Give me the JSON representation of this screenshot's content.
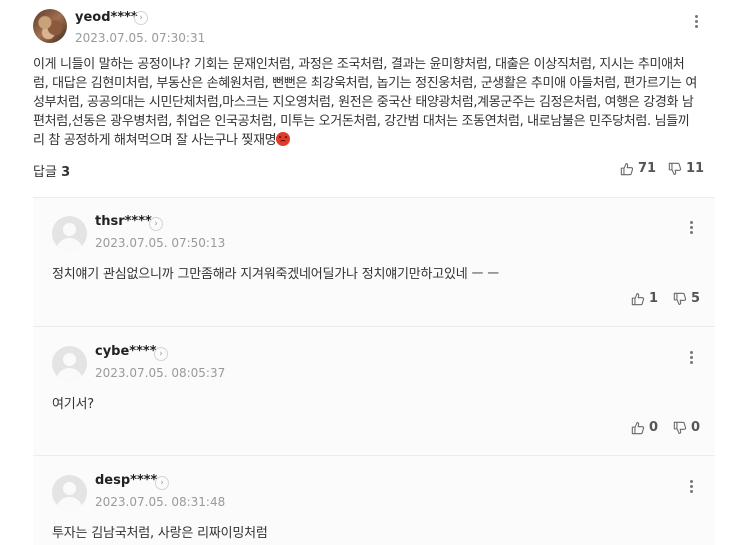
{
  "main_comment": {
    "username": "yeod****",
    "date": "2023.07.05. 07:30:31",
    "text": "이게 니들이 말하는 공정이냐? 기회는 문재인처럼, 과정은 조국처럼, 결과는 윤미향처럼, 대출은 이상직처럼, 지시는 추미애처럼, 대답은 김현미처럼, 부동산은 손혜원처럼, 뻔뻔은 최강욱처럼, 놉기는 정진웅처럼, 군생활은 추미애 아들처럼, 편가르기는 여성부처럼, 공공의대는 시민단체처럼,마스크는 지오영처럼, 원전은 중국산 태양광처럼,계몽군주는 김정은처럼, 여행은 강경화 남편처럼,선동은 광우병처럼, 취업은 인국공처럼, 미투는 오거돈처럼, 강간범 대처는 조동연처럼, 내로남불은 민주당처럼. 님들끼리 참 공정하게 해쳐먹으며 잘 사는구나 찢재명",
    "reply_label": "답글",
    "reply_count": "3",
    "likes": "71",
    "dislikes": "11"
  },
  "replies": [
    {
      "username": "thsr****",
      "date": "2023.07.05. 07:50:13",
      "text": "정치얘기 관심없으니까 그만좀해라 지겨워죽겠네어딜가나 정치얘기만하고있네 ㅡ ㅡ",
      "likes": "1",
      "dislikes": "5"
    },
    {
      "username": "cybe****",
      "date": "2023.07.05. 08:05:37",
      "text": "여기서?",
      "likes": "0",
      "dislikes": "0"
    },
    {
      "username": "desp****",
      "date": "2023.07.05. 08:31:48",
      "text": "투자는 김남국처럼, 사랑은 리짜이밍처럼"
    }
  ],
  "icons": {
    "profile_arrow": "chevron-right-icon",
    "more": "more-vertical-icon",
    "like": "thumbs-up-icon",
    "dislike": "thumbs-down-icon",
    "angry_emoji": "angry-face-icon"
  },
  "colors": {
    "meta_text": "#9a9a9a",
    "reply_bg": "#fbfbfb",
    "emoji": "#e23a2b"
  }
}
